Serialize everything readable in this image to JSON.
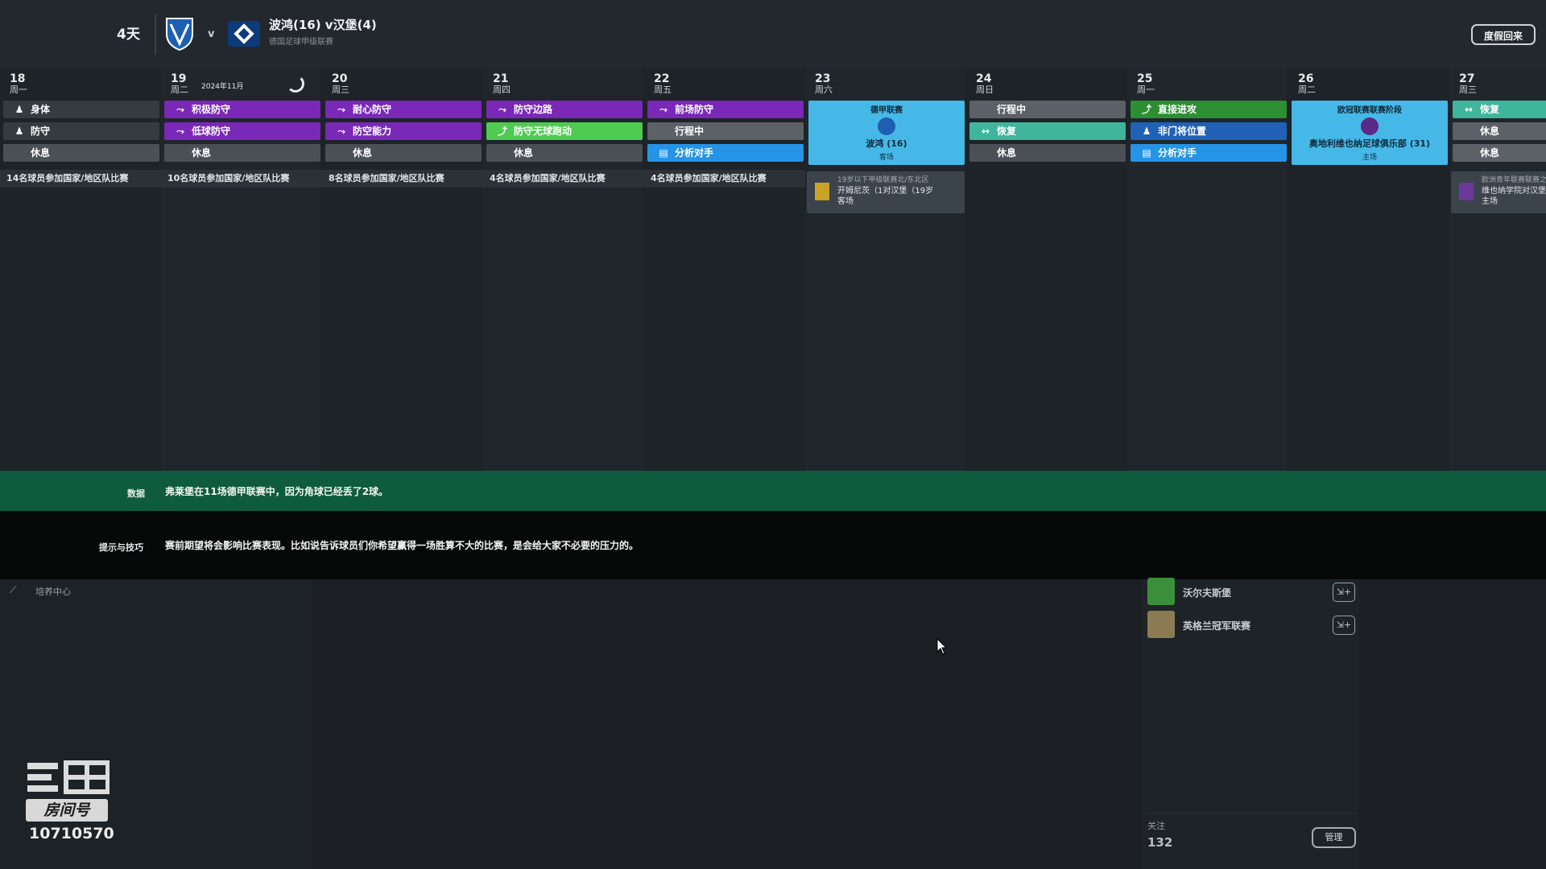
{
  "header": {
    "countdown": "4天",
    "vs": "v",
    "match_title": "波鸿(16) v汉堡(4)",
    "competition": "德国足球甲级联赛",
    "holiday_button": "度假回来",
    "home_crest_icon": "bochum-crest-icon",
    "away_crest_icon": "hamburg-crest-icon"
  },
  "calendar": {
    "month_label": "2024年11月",
    "days": [
      {
        "num": "18",
        "weekday": "周一",
        "slots": [
          {
            "label": "身体",
            "icon": "person-icon",
            "color": "#353b41"
          },
          {
            "label": "防守",
            "icon": "person-icon",
            "color": "#353b41"
          },
          {
            "label": "休息",
            "icon": "",
            "color": "#4a5055"
          }
        ],
        "bar": "14名球员参加国家/地区队比赛"
      },
      {
        "num": "19",
        "weekday": "周二",
        "slots": [
          {
            "label": "积极防守",
            "icon": "tackle-icon",
            "color": "#7a28b8"
          },
          {
            "label": "低球防守",
            "icon": "tackle-icon",
            "color": "#7a28b8"
          },
          {
            "label": "休息",
            "icon": "",
            "color": "#4a5055"
          }
        ],
        "bar": "10名球员参加国家/地区队比赛"
      },
      {
        "num": "20",
        "weekday": "周三",
        "slots": [
          {
            "label": "耐心防守",
            "icon": "tackle-icon",
            "color": "#7a28b8"
          },
          {
            "label": "防空能力",
            "icon": "tackle-icon",
            "color": "#7a28b8"
          },
          {
            "label": "休息",
            "icon": "",
            "color": "#4a5055"
          }
        ],
        "bar": "8名球员参加国家/地区队比赛"
      },
      {
        "num": "21",
        "weekday": "周四",
        "slots": [
          {
            "label": "防守边路",
            "icon": "tackle-icon",
            "color": "#7a28b8"
          },
          {
            "label": "防守无球跑动",
            "icon": "run-icon",
            "color": "#4fcb52"
          },
          {
            "label": "休息",
            "icon": "",
            "color": "#4a5055"
          }
        ],
        "bar": "4名球员参加国家/地区队比赛"
      },
      {
        "num": "22",
        "weekday": "周五",
        "slots": [
          {
            "label": "前场防守",
            "icon": "tackle-icon",
            "color": "#7a28b8"
          },
          {
            "label": "行程中",
            "icon": "",
            "color": "#5b6166"
          },
          {
            "label": "分析对手",
            "icon": "clipboard-icon",
            "color": "#2594e6"
          }
        ],
        "bar": "4名球员参加国家/地区队比赛"
      },
      {
        "num": "23",
        "weekday": "周六",
        "match": {
          "competition": "德甲联赛",
          "opponent": "波鸿 (16)",
          "venue": "客场"
        },
        "youth": {
          "title": "19岁以下甲级联赛北/东北区",
          "match": "开姆尼茨（1对汉堡（19岁",
          "venue": "客场"
        }
      },
      {
        "num": "24",
        "weekday": "周日",
        "slots": [
          {
            "label": "行程中",
            "icon": "",
            "color": "#5b6166"
          },
          {
            "label": "恢复",
            "icon": "recovery-icon",
            "color": "#3fb59c"
          },
          {
            "label": "休息",
            "icon": "",
            "color": "#4a5055"
          }
        ]
      },
      {
        "num": "25",
        "weekday": "周一",
        "slots": [
          {
            "label": "直接进攻",
            "icon": "run-icon",
            "color": "#2c8f32"
          },
          {
            "label": "非门将位置",
            "icon": "person-icon",
            "color": "#1f62b6"
          },
          {
            "label": "分析对手",
            "icon": "clipboard-icon",
            "color": "#2594e6"
          }
        ]
      },
      {
        "num": "26",
        "weekday": "周二",
        "match": {
          "competition": "欧冠联赛联赛阶段",
          "opponent": "奥地利维也纳足球俱乐部 (31)",
          "venue": "主场"
        }
      },
      {
        "num": "27",
        "weekday": "周三",
        "slots": [
          {
            "label": "恢复",
            "icon": "recovery-icon",
            "color": "#3fb59c"
          },
          {
            "label": "休息",
            "icon": "",
            "color": "#5b6166"
          },
          {
            "label": "休息",
            "icon": "",
            "color": "#5b6166"
          }
        ],
        "youth": {
          "title": "欧洲青年联赛联赛之",
          "match": "维也纳学院对汉堡",
          "venue": "主场"
        }
      }
    ]
  },
  "fact": {
    "label": "数据",
    "text": "弗莱堡在11场德甲联赛中，因为角球已经丢了2球。"
  },
  "tip": {
    "label": "提示与技巧",
    "text": "赛前期望将会影响比赛表现。比如说告诉球员们你希望赢得一场胜算不大的比赛，是会给大家不必要的压力的。"
  },
  "development": {
    "label": "培养中心"
  },
  "following": {
    "items": [
      {
        "name": "沃尔夫斯堡",
        "logo_color": "#3b8f3a"
      },
      {
        "name": "英格兰冠军联赛",
        "logo_color": "#8a7b52"
      }
    ],
    "label": "关注",
    "count": "132",
    "manage_button": "管理"
  },
  "watermark": {
    "room_label": "房间号",
    "room_number": "10710570"
  }
}
